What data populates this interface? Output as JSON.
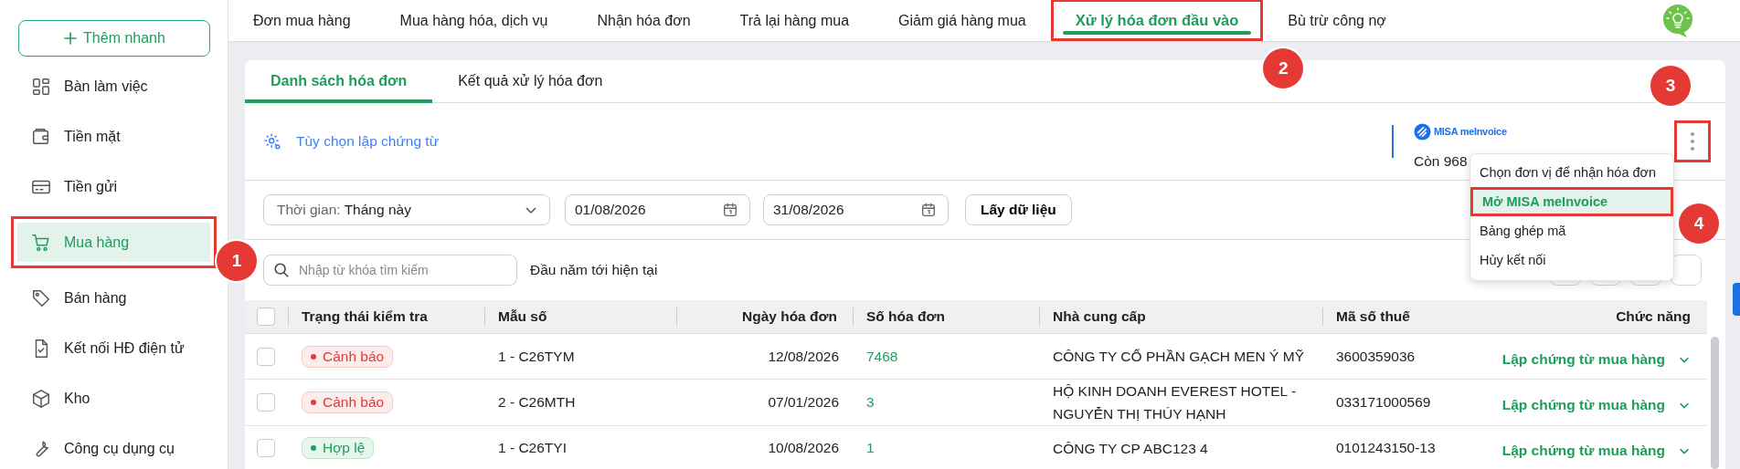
{
  "sidebar": {
    "quick_add": "Thêm nhanh",
    "items": [
      {
        "label": "Bàn làm việc",
        "selected": false
      },
      {
        "label": "Tiền mặt",
        "selected": false
      },
      {
        "label": "Tiền gửi",
        "selected": false
      },
      {
        "label": "Mua hàng",
        "selected": true,
        "callout": "1"
      },
      {
        "label": "Bán hàng",
        "selected": false
      },
      {
        "label": "Kết nối HĐ điện tử",
        "selected": false
      },
      {
        "label": "Kho",
        "selected": false
      },
      {
        "label": "Công cụ dụng cụ",
        "selected": false
      }
    ]
  },
  "top_tabs": [
    {
      "label": "Đơn mua hàng",
      "selected": false
    },
    {
      "label": "Mua hàng hóa, dịch vụ",
      "selected": false
    },
    {
      "label": "Nhận hóa đơn",
      "selected": false
    },
    {
      "label": "Trả lại hàng mua",
      "selected": false
    },
    {
      "label": "Giảm giá hàng mua",
      "selected": false
    },
    {
      "label": "Xử lý hóa đơn đầu vào",
      "selected": true,
      "callout": "2"
    },
    {
      "label": "Bù trừ công nợ",
      "selected": false
    }
  ],
  "card": {
    "tabs": [
      {
        "label": "Danh sách hóa đơn",
        "selected": true
      },
      {
        "label": "Kết quả xử lý hóa đơn",
        "selected": false
      }
    ],
    "options_link": "Tùy chọn lập chứng từ",
    "provider": {
      "logo_text": "MISA meInvoice",
      "remaining": "Còn 968"
    },
    "more_button": {
      "callout": "3"
    },
    "menu": {
      "items": [
        {
          "label": "Chọn đơn vị để nhận hóa đơn",
          "selected": false
        },
        {
          "label": "Mở MISA meInvoice",
          "selected": true,
          "callout": "4"
        },
        {
          "label": "Bảng ghép mã",
          "selected": false
        },
        {
          "label": "Hủy kết nối",
          "selected": false
        }
      ]
    },
    "filters": {
      "period": {
        "label": "Thời gian:",
        "value": "Tháng này"
      },
      "from": "01/08/2026",
      "to": "31/08/2026",
      "fetch_button": "Lấy dữ liệu"
    },
    "search": {
      "placeholder": "Nhập từ khóa tìm kiếm"
    },
    "range_label": "Đầu năm tới hiện tại",
    "table": {
      "select_all": {
        "checked": false
      },
      "columns": [
        "Trạng thái kiểm tra",
        "Mẫu số",
        "Ngày hóa đơn",
        "Số hóa đơn",
        "Nhà cung cấp",
        "Mã số thuế",
        "Chức năng"
      ],
      "rows": [
        {
          "checked": false,
          "status": {
            "label": "Cảnh báo",
            "kind": "warning"
          },
          "template": "1 - C26TYM",
          "date": "12/08/2026",
          "number": "7468",
          "supplier": "CÔNG TY CỔ PHẦN GẠCH MEN Ý MỸ",
          "tax_code": "3600359036",
          "action": "Lập chứng từ mua hàng"
        },
        {
          "checked": false,
          "status": {
            "label": "Cảnh báo",
            "kind": "warning"
          },
          "template": "2 - C26MTH",
          "date": "07/01/2026",
          "number": "3",
          "supplier": "HỘ KINH DOANH EVEREST HOTEL - NGUYỄN THỊ THÚY HẠNH",
          "tax_code": "033171000569",
          "action": "Lập chứng từ mua hàng"
        },
        {
          "checked": false,
          "status": {
            "label": "Hợp lệ",
            "kind": "valid"
          },
          "template": "1 - C26TYI",
          "date": "10/08/2026",
          "number": "1",
          "supplier": "CÔNG TY CP ABC123 4",
          "tax_code": "0101243150-13",
          "action": "Lập chứng từ mua hàng"
        }
      ]
    }
  }
}
